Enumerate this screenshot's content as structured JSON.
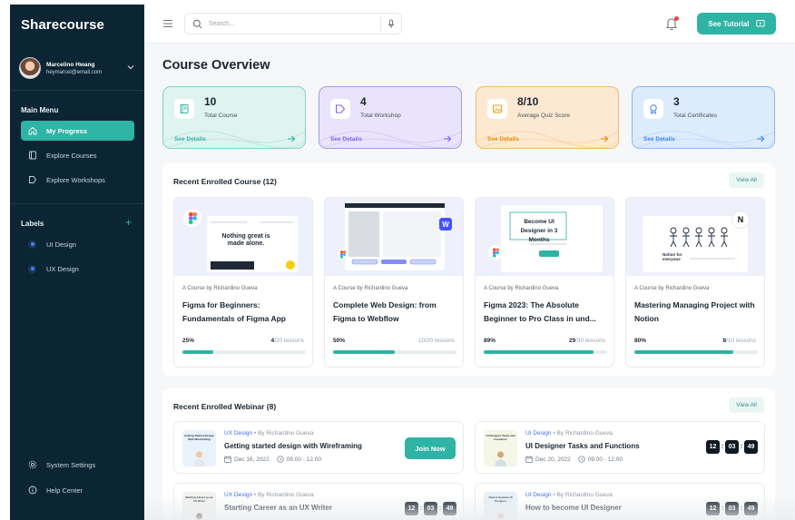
{
  "brand": "Sharecourse",
  "user": {
    "name": "Marcelino Hwang",
    "email": "heymarcel@email.com"
  },
  "sidebar": {
    "main_menu_label": "Main Menu",
    "items": [
      {
        "label": "My Progress",
        "icon": "home-icon",
        "active": true
      },
      {
        "label": "Explore Courses",
        "icon": "book-icon",
        "active": false
      },
      {
        "label": "Explore Workshops",
        "icon": "video-icon",
        "active": false
      }
    ],
    "labels_title": "Labels",
    "labels": [
      {
        "label": "UI Design"
      },
      {
        "label": "UX Design"
      }
    ],
    "bottom": [
      {
        "label": "System Settings",
        "icon": "gear-icon"
      },
      {
        "label": "Help Center",
        "icon": "info-icon"
      }
    ]
  },
  "topbar": {
    "search_placeholder": "Search...",
    "tutorial_label": "See Tutorial"
  },
  "page_title": "Course Overview",
  "stats": [
    {
      "value": "10",
      "label": "Total Course",
      "link": "See Details",
      "color": "#2fb3a4",
      "icon": "book-icon"
    },
    {
      "value": "4",
      "label": "Total Workshop",
      "link": "See Details",
      "color": "#7c5cf0",
      "icon": "video-icon"
    },
    {
      "value": "8/10",
      "label": "Average Quiz Score",
      "link": "See Details",
      "color": "#f59e0b",
      "icon": "image-icon"
    },
    {
      "value": "3",
      "label": "Total Certificates",
      "link": "See Details",
      "color": "#3b82f6",
      "icon": "badge-icon"
    }
  ],
  "recent_courses": {
    "title": "Recent Enrolled Course (12)",
    "view_all": "View All",
    "items": [
      {
        "by": "A Course by Richardino Gueva",
        "title": "Figma for Beginners: Fundamentals of Figma App",
        "percent_label": "25%",
        "progress": 0.25,
        "lessons_done": "4",
        "lessons_total": "/20 lessons",
        "thumb_text": "Nothing great is made alone."
      },
      {
        "by": "A Course by Richardino Gueva",
        "title": "Complete Web Design: from Figma to Webflow",
        "percent_label": "50%",
        "progress": 0.5,
        "lessons_done": "",
        "lessons_total": "10/20 lessons",
        "thumb_text": ""
      },
      {
        "by": "A Course by Richardino Gueva",
        "title": "Figma 2023: The Absolute Beginner to Pro Class in und...",
        "percent_label": "89%",
        "progress": 0.89,
        "lessons_done": "29",
        "lessons_total": "/30 lessons",
        "thumb_text": "Become UI Designer in 3 Months"
      },
      {
        "by": "A Course by Richardino Gueva",
        "title": "Mastering Managing Project with Notion",
        "percent_label": "80%",
        "progress": 0.8,
        "lessons_done": "8",
        "lessons_total": "/10 lessons",
        "thumb_text": "Notion for everyone"
      }
    ]
  },
  "recent_webinars": {
    "title": "Recent Enrolled Webinar (8)",
    "view_all": "View All",
    "items": [
      {
        "tag": "UX Design",
        "by": "By Richardino Gueva",
        "title": "Getting started design with Wireframing",
        "date": "Dec 16, 2022",
        "time": "09.00 - 12.00",
        "action": "Join Now",
        "thumb_title": "Getting Started Design With Wireframing"
      },
      {
        "tag": "UI Design",
        "by": "By Richardino Gueva",
        "title": "UI Designer Tasks and Functions",
        "date": "Dec 20, 2022",
        "time": "09.00 - 12.00",
        "timer": [
          "12",
          "03",
          "49"
        ],
        "thumb_title": "UI Designer Tasks and Functions"
      },
      {
        "tag": "UX Design",
        "by": "By Richardino Gueva",
        "title": "Starting Career as an UX Writer",
        "date": "",
        "time": "",
        "timer": [
          "12",
          "03",
          "49"
        ],
        "thumb_title": "Starting Career as an UX Writer"
      },
      {
        "tag": "UI Design",
        "by": "By Richardino Gueva",
        "title": "How to become UI Designer",
        "date": "",
        "time": "",
        "timer": [
          "12",
          "03",
          "49"
        ],
        "thumb_title": "How to become UI Designer"
      }
    ]
  },
  "colors": {
    "sidebar": "#0b2535",
    "accent": "#2fb3a4"
  }
}
